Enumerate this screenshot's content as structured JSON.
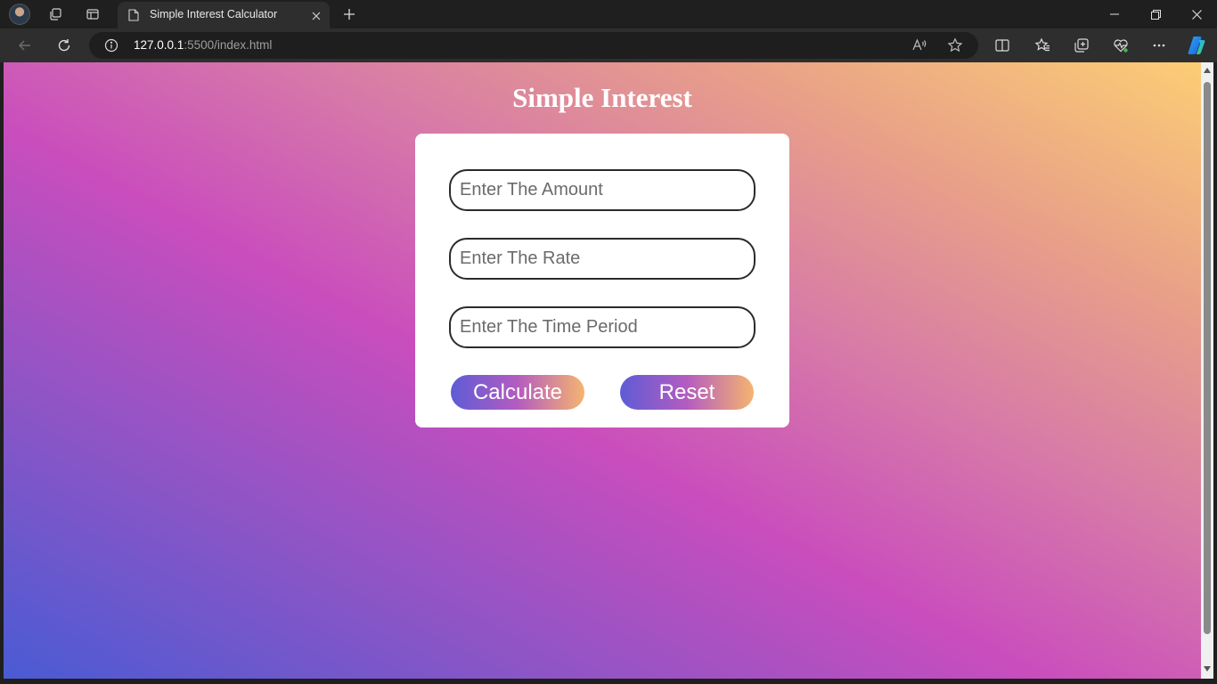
{
  "browser": {
    "tab_title": "Simple Interest Calculator",
    "url_host": "127.0.0.1",
    "url_rest": ":5500/index.html"
  },
  "page": {
    "title": "Simple Interest",
    "amount_placeholder": "Enter The Amount",
    "rate_placeholder": "Enter The Rate",
    "time_placeholder": "Enter The Time Period",
    "calculate_label": "Calculate",
    "reset_label": "Reset"
  },
  "colors": {
    "gradient_start": "#4a5bd4",
    "gradient_mid": "#c94dbd",
    "gradient_end": "#fccd75",
    "button_start": "#5e5cd6",
    "button_end": "#f5b46f"
  }
}
